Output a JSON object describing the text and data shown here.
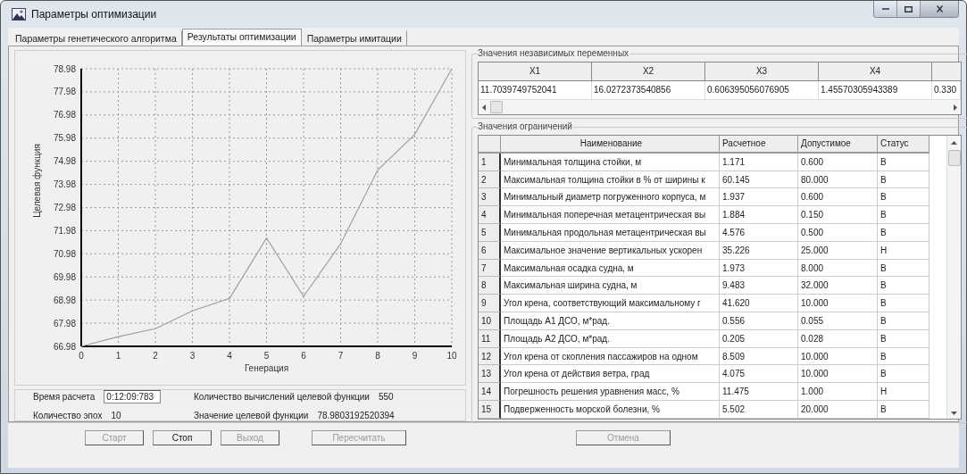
{
  "window": {
    "title": "Параметры оптимизации"
  },
  "tabs": [
    {
      "label": "Параметры генетического алгоритма",
      "selected": false
    },
    {
      "label": "Результаты оптимизации",
      "selected": true
    },
    {
      "label": "Параметры имитации",
      "selected": false
    }
  ],
  "chart": {
    "chart_data": {
      "type": "line",
      "xlabel": "Генерация",
      "ylabel": "Целевая функция",
      "x": [
        0,
        1,
        2,
        3,
        4,
        5,
        6,
        7,
        8,
        9,
        10
      ],
      "series": [
        {
          "color": "#a0a0a0",
          "values": [
            66.98,
            67.4,
            67.74,
            68.51,
            69.05,
            71.66,
            69.14,
            71.41,
            74.6,
            76.14,
            78.98
          ]
        }
      ],
      "grid": true,
      "xlim": [
        0,
        10
      ],
      "ylim": [
        66.98,
        78.98
      ],
      "xticks": [
        0,
        1,
        2,
        3,
        4,
        5,
        6,
        7,
        8,
        9,
        10
      ],
      "yticks": [
        66.98,
        67.98,
        68.98,
        69.98,
        70.98,
        71.98,
        72.98,
        73.98,
        74.98,
        75.98,
        76.98,
        77.98,
        78.98
      ]
    }
  },
  "stats": [
    {
      "label": "Время расчета",
      "value": "0:12:09:783",
      "kind": "field"
    },
    {
      "label": "Количество вычислений целевой функции",
      "value": "550",
      "kind": "text"
    },
    {
      "label": "Количество эпох",
      "value": "10",
      "kind": "text"
    },
    {
      "label": "Значение целевой функции",
      "value": "78.9803192520394",
      "kind": "text"
    }
  ],
  "variables": {
    "title": "Значения независимых переменных",
    "columns": [
      "X1",
      "X2",
      "X3",
      "X4"
    ],
    "values": [
      "11.7039749752041",
      "16.0272373540856",
      "0.606395056076905",
      "1.45570305943389",
      "0.330"
    ]
  },
  "constraints": {
    "title": "Значения ограничений",
    "columns": [
      "Наименование",
      "Расчетное",
      "Допустимое",
      "Статус"
    ],
    "rows": [
      {
        "index": "1",
        "name": "Минимальная толщина стойки, м",
        "calc": "1.171",
        "allowed": "0.600",
        "status": "В"
      },
      {
        "index": "2",
        "name": "Максимальная толщина стойки в % от ширины к",
        "calc": "60.145",
        "allowed": "80.000",
        "status": "В"
      },
      {
        "index": "3",
        "name": "Минимальный диаметр погруженного корпуса, м",
        "calc": "1.937",
        "allowed": "0.600",
        "status": "В"
      },
      {
        "index": "4",
        "name": "Минимальная поперечная метацентрическая вы",
        "calc": "1.884",
        "allowed": "0.150",
        "status": "В"
      },
      {
        "index": "5",
        "name": "Минимальная продольная метацентрическая вы",
        "calc": "4.576",
        "allowed": "0.500",
        "status": "В"
      },
      {
        "index": "6",
        "name": "Максимальное значение вертикальных ускорен",
        "calc": "35.226",
        "allowed": "25.000",
        "status": "Н"
      },
      {
        "index": "7",
        "name": "Максимальная осадка судна, м",
        "calc": "1.973",
        "allowed": "8.000",
        "status": "В"
      },
      {
        "index": "8",
        "name": "Максимальная ширина судна, м",
        "calc": "9.483",
        "allowed": "32.000",
        "status": "В"
      },
      {
        "index": "9",
        "name": "Угол крена, соответствующий максимальному г",
        "calc": "41.620",
        "allowed": "10.000",
        "status": "В"
      },
      {
        "index": "10",
        "name": "Площадь А1 ДСО, м*рад.",
        "calc": "0.556",
        "allowed": "0.055",
        "status": "В"
      },
      {
        "index": "11",
        "name": "Площадь А2 ДСО, м*рад.",
        "calc": "0.205",
        "allowed": "0.028",
        "status": "В"
      },
      {
        "index": "12",
        "name": "Угол крена от скопления пассажиров на одном",
        "calc": "8.509",
        "allowed": "10.000",
        "status": "В"
      },
      {
        "index": "13",
        "name": "Угол крена от действия ветра, град",
        "calc": "4.075",
        "allowed": "10.000",
        "status": "В"
      },
      {
        "index": "14",
        "name": "Погрешность решения уравнения масс, %",
        "calc": "11.475",
        "allowed": "1.000",
        "status": "Н"
      },
      {
        "index": "15",
        "name": "Подверженность морской болезни, %",
        "calc": "5.502",
        "allowed": "20.000",
        "status": "В"
      }
    ]
  },
  "buttons": [
    {
      "label": "Старт",
      "disabled": true
    },
    {
      "label": "Стоп",
      "disabled": false
    },
    {
      "label": "Выход",
      "disabled": true
    },
    {
      "label": "Пересчитать",
      "disabled": true
    },
    {
      "label": "Отмена",
      "disabled": true
    }
  ]
}
